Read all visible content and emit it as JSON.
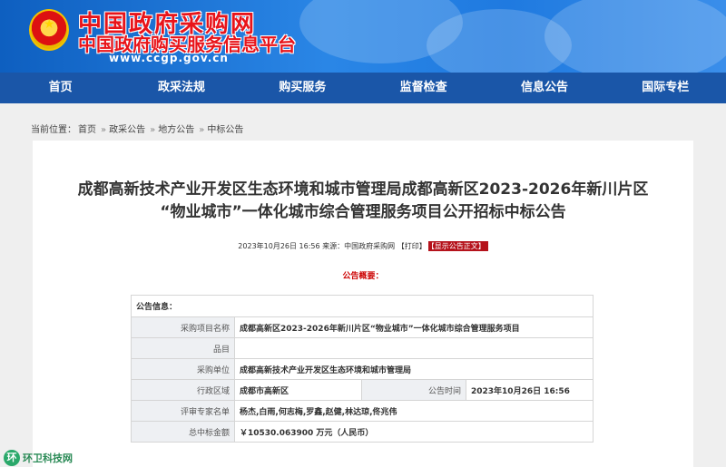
{
  "header": {
    "title": "中国政府采购网",
    "subtitle": "中国政府购买服务信息平台",
    "url": "www.ccgp.gov.cn"
  },
  "nav": [
    {
      "label": "首页"
    },
    {
      "label": "政采法规"
    },
    {
      "label": "购买服务"
    },
    {
      "label": "监督检查"
    },
    {
      "label": "信息公告"
    },
    {
      "label": "国际专栏"
    }
  ],
  "breadcrumb": {
    "prefix": "当前位置：",
    "items": [
      "首页",
      "政采公告",
      "地方公告",
      "中标公告"
    ]
  },
  "document": {
    "title_line1": "成都高新技术产业开发区生态环境和城市管理局成都高新区2023-2026年新川片区",
    "title_line2": "“物业城市”一体化城市综合管理服务项目公开招标中标公告",
    "meta": "2023年10月26日 16:56 来源：中国政府采购网 【打印】",
    "show_text_button": "【显示公告正文】",
    "summary_label": "公告概要："
  },
  "table": {
    "header": "公告信息：",
    "rows": {
      "project_name_label": "采购项目名称",
      "project_name_value": "成都高新区2023-2026年新川片区“物业城市”一体化城市综合管理服务项目",
      "category_label": "品目",
      "category_value": "",
      "unit_label": "采购单位",
      "unit_value": "成都高新技术产业开发区生态环境和城市管理局",
      "region_label": "行政区域",
      "region_value": "成都市高新区",
      "time_label": "公告时间",
      "time_value": "2023年10月26日  16:56",
      "experts_label": "评审专家名单",
      "experts_value": "杨杰,白雨,何志梅,罗鑫,赵健,林达琼,佟兆伟",
      "amount_label": "总中标金额",
      "amount_value": "￥10530.063900 万元（人民币）"
    }
  },
  "watermark": {
    "icon": "环",
    "text": "环卫科技网"
  }
}
